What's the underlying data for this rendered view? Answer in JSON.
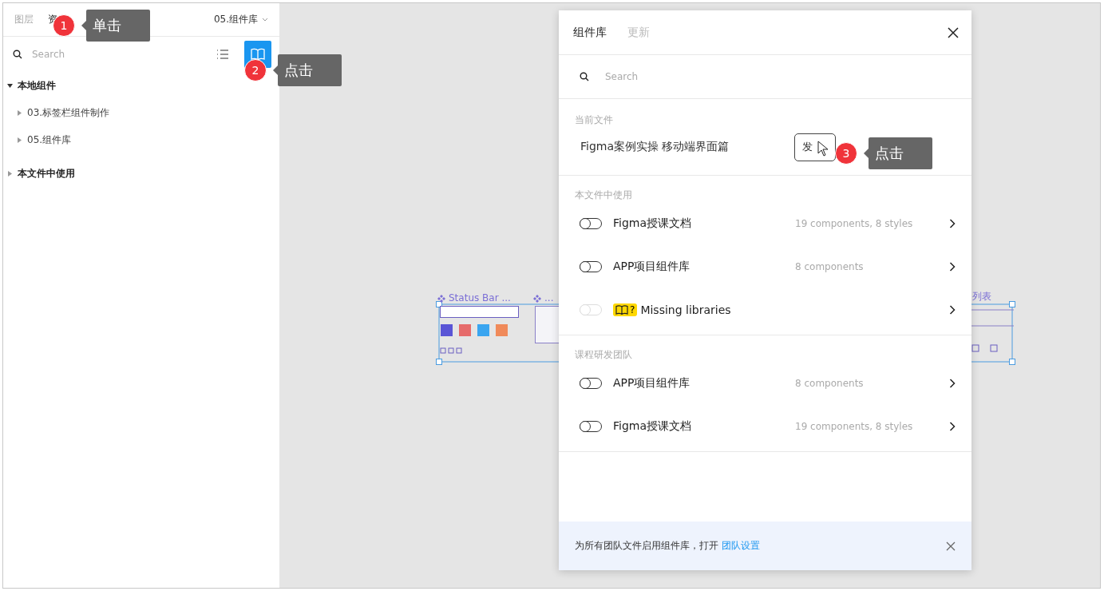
{
  "sidebar": {
    "tabs": [
      {
        "label": "图层",
        "selected": false
      },
      {
        "label": "资",
        "selected": true
      }
    ],
    "page_menu": "05.组件库",
    "search": {
      "placeholder": "Search"
    },
    "view_buttons": [
      {
        "kind": "list",
        "selected": false
      },
      {
        "kind": "library",
        "selected": true
      }
    ],
    "sections": [
      {
        "label": "本地组件",
        "expanded": true,
        "children": [
          {
            "label": "03.标签栏组件制作",
            "expanded": false
          },
          {
            "label": "05.组件库",
            "expanded": false
          }
        ]
      },
      {
        "label": "本文件中使用",
        "expanded": false
      }
    ]
  },
  "canvas": {
    "frames": [
      {
        "label": "Status Bar ..."
      },
      {
        "label": "..."
      },
      {
        "label": "列表"
      }
    ]
  },
  "dialog": {
    "tabs": [
      {
        "label": "组件库",
        "selected": true
      },
      {
        "label": "更新",
        "selected": false
      }
    ],
    "search": {
      "placeholder": "Search"
    },
    "current_file": {
      "heading": "当前文件",
      "name": "Figma案例实操 移动端界面篇",
      "button": "发"
    },
    "groups": [
      {
        "heading": "本文件中使用",
        "libraries": [
          {
            "kind": "library",
            "on": false,
            "disabled": false,
            "name": "Figma授课文档",
            "info": "19 components, 8 styles"
          },
          {
            "kind": "library",
            "on": false,
            "disabled": false,
            "name": "APP项目组件库",
            "info": "8 components"
          },
          {
            "kind": "missing",
            "on": false,
            "disabled": true,
            "badge": "?",
            "name": "Missing libraries"
          }
        ]
      },
      {
        "heading": "课程研发团队",
        "libraries": [
          {
            "kind": "library",
            "on": false,
            "disabled": false,
            "name": "APP项目组件库",
            "info": "8 components"
          },
          {
            "kind": "library",
            "on": false,
            "disabled": false,
            "name": "Figma授课文档",
            "info": "19 components, 8 styles"
          }
        ]
      }
    ],
    "footer": {
      "text": "为所有团队文件启用组件库，打开",
      "link": "团队设置"
    }
  },
  "annotations": [
    {
      "number": "1",
      "label": "单击"
    },
    {
      "number": "2",
      "label": "点击"
    },
    {
      "number": "3",
      "label": "点击"
    }
  ]
}
